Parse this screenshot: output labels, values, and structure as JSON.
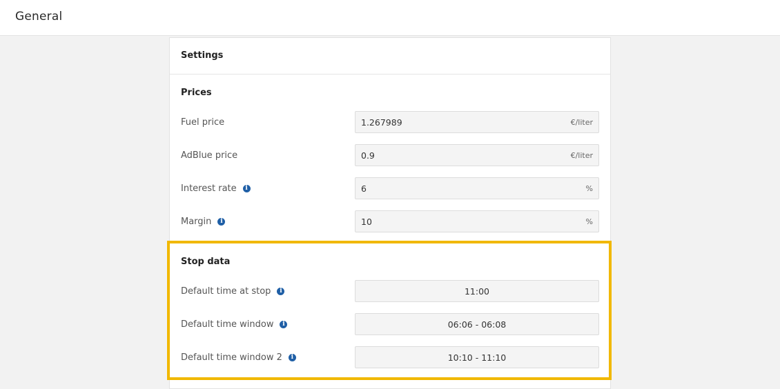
{
  "topbar": {
    "title": "General"
  },
  "panel": {
    "header": "Settings"
  },
  "prices": {
    "title": "Prices",
    "fuel": {
      "label": "Fuel price",
      "value": "1.267989",
      "unit": "€/liter"
    },
    "adblue": {
      "label": "AdBlue price",
      "value": "0.9",
      "unit": "€/liter"
    },
    "interest": {
      "label": "Interest rate",
      "value": "6",
      "unit": "%"
    },
    "margin": {
      "label": "Margin",
      "value": "10",
      "unit": "%"
    }
  },
  "stop_data": {
    "title": "Stop data",
    "time_at_stop": {
      "label": "Default time at stop",
      "value": "11:00"
    },
    "time_window": {
      "label": "Default time window",
      "value": "06:06 - 06:08"
    },
    "time_window_2": {
      "label": "Default time window 2",
      "value": "10:10 - 11:10"
    }
  },
  "icons": {
    "info": "i"
  },
  "colors": {
    "highlight": "#f1b800",
    "info_icon": "#1f5fa6"
  }
}
